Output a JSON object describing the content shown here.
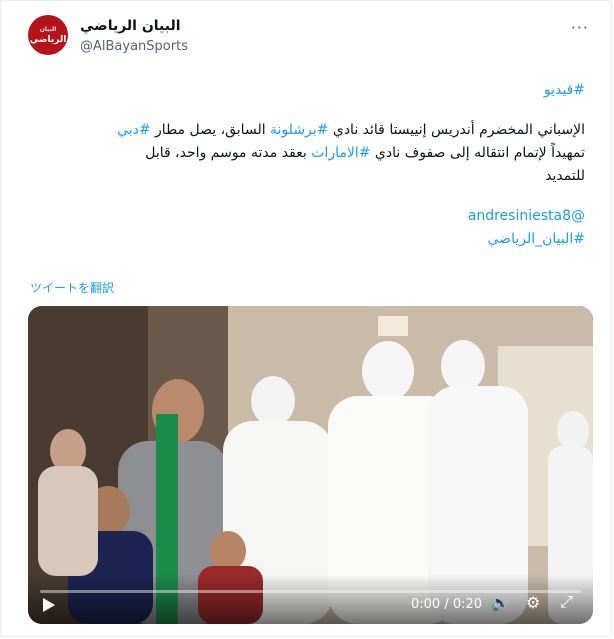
{
  "author": {
    "name": "البيان الرياضي",
    "handle": "@AlBayanSports",
    "avatar_text_top": "البيان",
    "avatar_text_main": "الرياضي"
  },
  "more_icon": "more-dots-icon",
  "tweet": {
    "hashtag_video": "#فيديو",
    "l1_a": "الإسباني المخضرم أندريس إنييستا قائد نادي ",
    "l1_tag1": "#برشلونة",
    "l1_b": " السابق، يصل مطار ",
    "l1_tag2": "#دبي",
    "l2_a": "تمهيداً لإتمام انتقاله إلى صفوف نادي ",
    "l2_tag": "#الامارات",
    "l2_b": " بعقد مدته موسم واحد، قابل",
    "l3": "للتمديد",
    "mention": "@andresiniesta8",
    "hashtag_bayan": "#البيان_الرياضي"
  },
  "translate_label": "ツイートを翻訳",
  "video": {
    "time": "0:00 / 0:20",
    "progress": 0,
    "icons": [
      "play-icon",
      "volume-icon",
      "settings-icon",
      "fullscreen-icon"
    ]
  },
  "colors": {
    "link": "#1d9bf0",
    "avatar_bg": "#b5121b"
  }
}
